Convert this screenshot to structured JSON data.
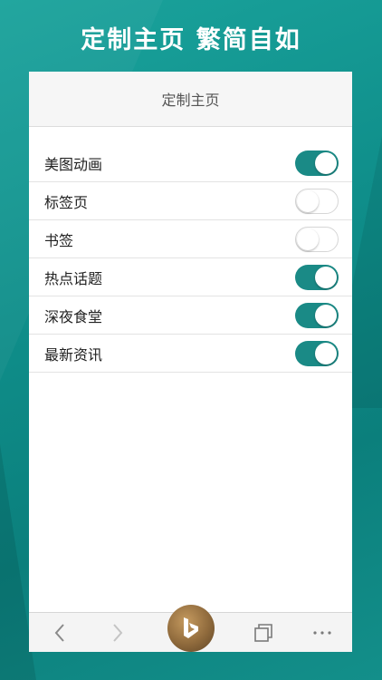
{
  "headline": "定制主页 繁简自如",
  "nav": {
    "title": "定制主页"
  },
  "settings": [
    {
      "label": "美图动画",
      "enabled": true
    },
    {
      "label": "标签页",
      "enabled": false
    },
    {
      "label": "书签",
      "enabled": false
    },
    {
      "label": "热点话题",
      "enabled": true
    },
    {
      "label": "深夜食堂",
      "enabled": true
    },
    {
      "label": "最新资讯",
      "enabled": true
    }
  ],
  "toolbar": {
    "icons": [
      "back-icon",
      "forward-icon",
      "bing-logo-icon",
      "tabs-icon",
      "more-icon"
    ]
  },
  "colors": {
    "accent": "#1a8a86",
    "background": "#0f8e8a"
  }
}
